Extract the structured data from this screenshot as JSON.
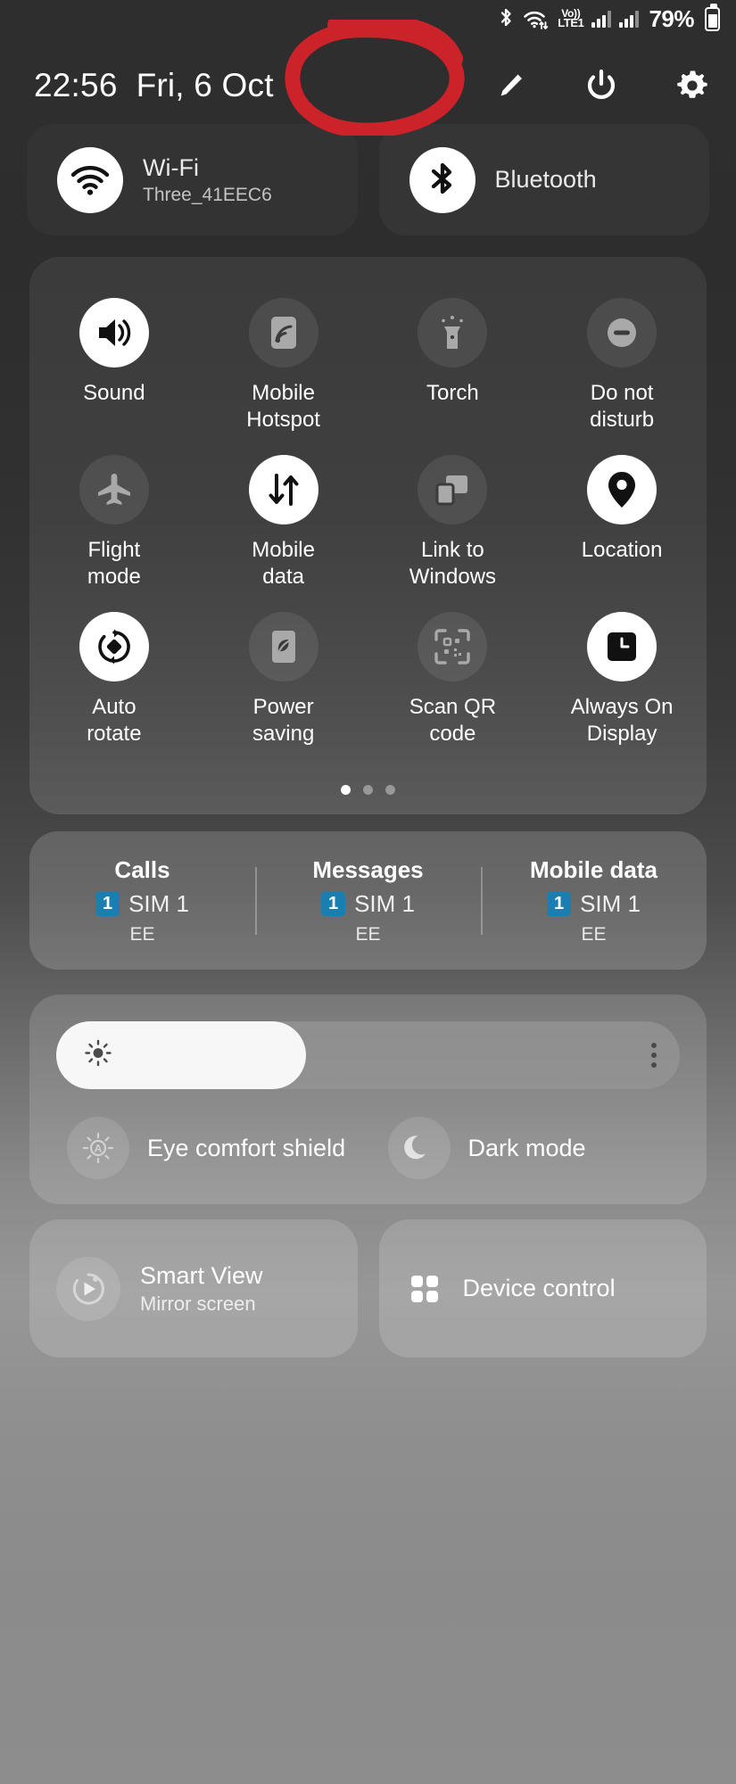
{
  "status_bar": {
    "bluetooth_icon": "bluetooth-icon",
    "wifi_icon": "wifi-transfer-icon",
    "volte_top": "Vo))",
    "volte_bottom": "LTE1",
    "signal_icon_1": "signal-bars-icon",
    "signal_icon_2": "signal-bars-icon",
    "battery_percent": "79%",
    "battery_icon": "battery-icon"
  },
  "header": {
    "time": "22:56",
    "date": "Fri, 6 Oct",
    "edit_icon": "pencil-edit-icon",
    "power_icon": "power-icon",
    "settings_icon": "gear-icon"
  },
  "annotation": {
    "color": "#cc2229",
    "shape": "hand-drawn-circle",
    "note": "red circle around edit and power buttons"
  },
  "connectivity": [
    {
      "title": "Wi-Fi",
      "subtitle": "Three_41EEC6",
      "icon": "wifi-icon",
      "state": "on"
    },
    {
      "title": "Bluetooth",
      "subtitle": "",
      "icon": "bluetooth-icon",
      "state": "on"
    }
  ],
  "tiles": [
    {
      "label": "Sound",
      "icon": "volume-speaker-icon",
      "state": "on"
    },
    {
      "label": "Mobile\nHotspot",
      "icon": "hotspot-icon",
      "state": "off"
    },
    {
      "label": "Torch",
      "icon": "flashlight-icon",
      "state": "off"
    },
    {
      "label": "Do not\ndisturb",
      "icon": "do-not-disturb-icon",
      "state": "off"
    },
    {
      "label": "Flight\nmode",
      "icon": "airplane-icon",
      "state": "off"
    },
    {
      "label": "Mobile\ndata",
      "icon": "data-transfer-icon",
      "state": "on"
    },
    {
      "label": "Link to\nWindows",
      "icon": "link-to-windows-icon",
      "state": "off"
    },
    {
      "label": "Location",
      "icon": "location-pin-icon",
      "state": "on"
    },
    {
      "label": "Auto\nrotate",
      "icon": "auto-rotate-icon",
      "state": "on"
    },
    {
      "label": "Power\nsaving",
      "icon": "power-saving-leaf-icon",
      "state": "off"
    },
    {
      "label": "Scan QR\ncode",
      "icon": "qr-scan-icon",
      "state": "off"
    },
    {
      "label": "Always On\nDisplay",
      "icon": "always-on-clock-icon",
      "state": "on"
    }
  ],
  "pagination": {
    "total": 3,
    "active_index": 0
  },
  "sim_panel": {
    "badge_color": "#1a7fb0",
    "columns": [
      {
        "header": "Calls",
        "badge": "1",
        "sim": "SIM 1",
        "carrier": "EE"
      },
      {
        "header": "Messages",
        "badge": "1",
        "sim": "SIM 1",
        "carrier": "EE"
      },
      {
        "header": "Mobile data",
        "badge": "1",
        "sim": "SIM 1",
        "carrier": "EE"
      }
    ]
  },
  "brightness": {
    "icon": "brightness-sun-icon",
    "value_percent": 40,
    "more_options_icon": "more-vertical-icon"
  },
  "display_toggles": [
    {
      "label": "Eye comfort shield",
      "icon": "eye-comfort-auto-icon",
      "state": "off"
    },
    {
      "label": "Dark mode",
      "icon": "moon-icon",
      "state": "off"
    }
  ],
  "bottom_cards": [
    {
      "title": "Smart View",
      "subtitle": "Mirror screen",
      "icon": "smart-view-play-icon"
    },
    {
      "title": "Device control",
      "subtitle": "",
      "icon": "device-control-grid-icon"
    }
  ]
}
